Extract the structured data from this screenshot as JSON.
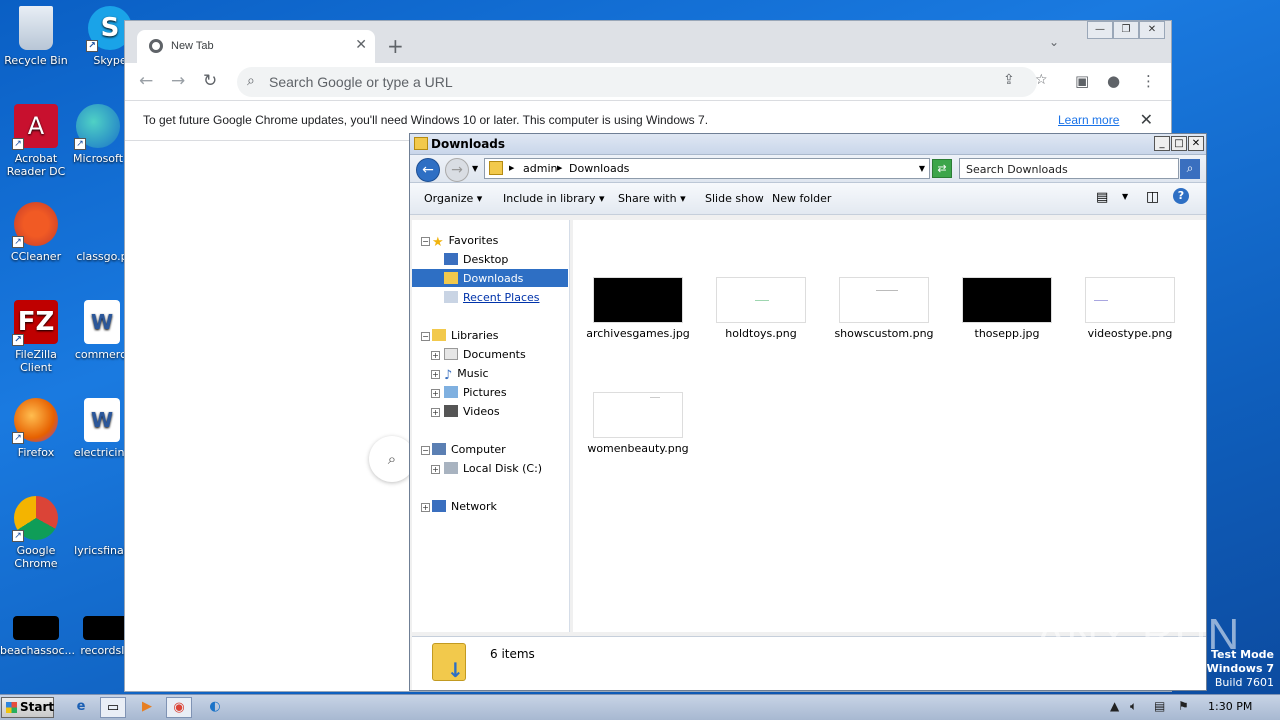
{
  "desktop": {
    "icons": [
      {
        "label": "Recycle Bin"
      },
      {
        "label": "Skype"
      },
      {
        "label": "Acrobat Reader DC"
      },
      {
        "label": "Microsoft"
      },
      {
        "label": "CCleaner"
      },
      {
        "label": "classgo.p"
      },
      {
        "label": "FileZilla Client"
      },
      {
        "label": "commerci"
      },
      {
        "label": "Firefox"
      },
      {
        "label": "electricins"
      },
      {
        "label": "Google Chrome"
      },
      {
        "label": "lyricsfinall"
      },
      {
        "label": "beachassoc..."
      },
      {
        "label": "recordslit"
      }
    ]
  },
  "chrome": {
    "tab_title": "New Tab",
    "omnibox_placeholder": "Search Google or type a URL",
    "infobar_message": "To get future Google Chrome updates, you'll need Windows 10 or later. This computer is using Windows 7.",
    "infobar_link": "Learn more"
  },
  "explorer": {
    "title": "Downloads",
    "breadcrumb": [
      "admin",
      "Downloads"
    ],
    "search_placeholder": "Search Downloads",
    "commands": [
      "Organize",
      "Include in library",
      "Share with",
      "Slide show",
      "New folder"
    ],
    "nav": {
      "favorites": "Favorites",
      "desktop": "Desktop",
      "downloads": "Downloads",
      "recent": "Recent Places",
      "libraries": "Libraries",
      "documents": "Documents",
      "music": "Music",
      "pictures": "Pictures",
      "videos": "Videos",
      "computer": "Computer",
      "local_disk": "Local Disk (C:)",
      "network": "Network"
    },
    "files": [
      {
        "name": "archivesgames.jpg",
        "thumb": "dark"
      },
      {
        "name": "holdtoys.png",
        "thumb": "light"
      },
      {
        "name": "showscustom.png",
        "thumb": "light"
      },
      {
        "name": "thosepp.jpg",
        "thumb": "dark"
      },
      {
        "name": "videostype.png",
        "thumb": "light"
      },
      {
        "name": "womenbeauty.png",
        "thumb": "light"
      }
    ],
    "status": "6 items"
  },
  "taskbar": {
    "start": "Start",
    "clock": "1:30 PM"
  },
  "watermark": "ANY RUN",
  "testmode": {
    "line1": "Test Mode",
    "line2": "Windows 7",
    "line3": "Build 7601"
  },
  "colors": {
    "desktop_blue": "#1a7ae0",
    "selection": "#2e6fc4",
    "chrome_link": "#1a73e8"
  }
}
